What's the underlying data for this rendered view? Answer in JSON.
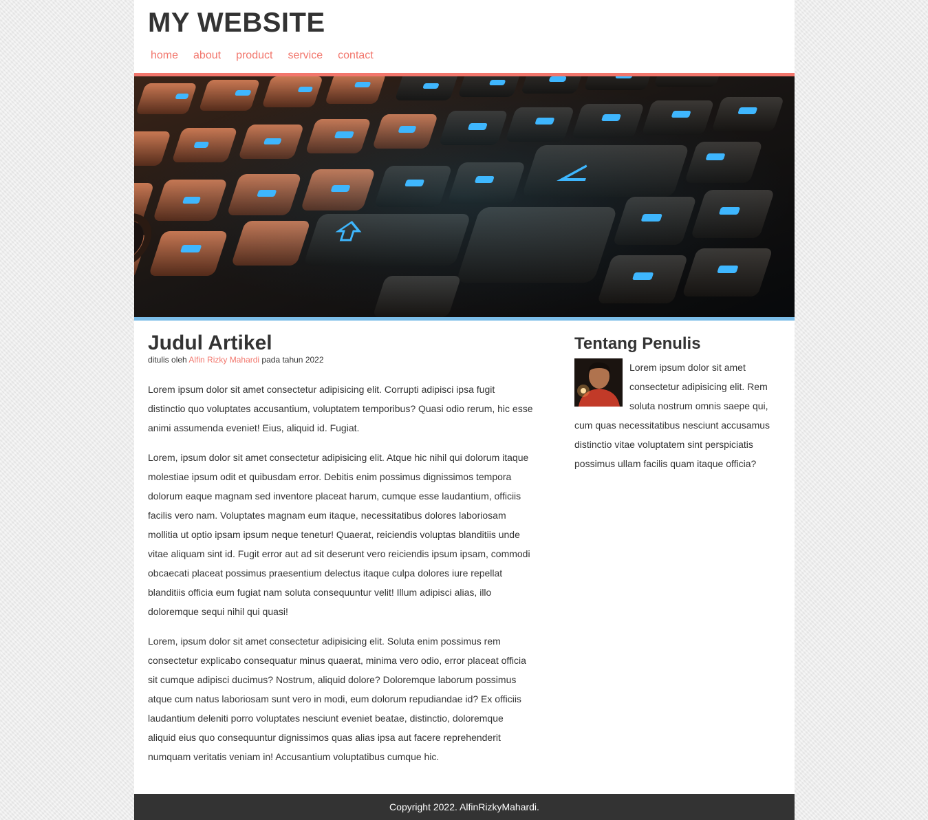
{
  "site": {
    "title": "MY WEBSITE"
  },
  "nav": {
    "items": [
      "home",
      "about",
      "product",
      "service",
      "contact"
    ]
  },
  "colors": {
    "accent": "#f2766c",
    "banner_rule": "#7bbde8",
    "footer_bg": "#333333"
  },
  "article": {
    "title": "Judul Artikel",
    "byline_prefix": "ditulis oleh",
    "author": "Alfin Rizky Mahardi",
    "byline_suffix": "pada tahun 2022",
    "paragraphs": [
      "Lorem ipsum dolor sit amet consectetur adipisicing elit. Corrupti adipisci ipsa fugit distinctio quo voluptates accusantium, voluptatem temporibus? Quasi odio rerum, hic esse animi assumenda eveniet! Eius, aliquid id. Fugiat.",
      "Lorem, ipsum dolor sit amet consectetur adipisicing elit. Atque hic nihil qui dolorum itaque molestiae ipsum odit et quibusdam error. Debitis enim possimus dignissimos tempora dolorum eaque magnam sed inventore placeat harum, cumque esse laudantium, officiis facilis vero nam. Voluptates magnam eum itaque, necessitatibus dolores laboriosam mollitia ut optio ipsam ipsum neque tenetur! Quaerat, reiciendis voluptas blanditiis unde vitae aliquam sint id. Fugit error aut ad sit deserunt vero reiciendis ipsum ipsam, commodi obcaecati placeat possimus praesentium delectus itaque culpa dolores iure repellat blanditiis officia eum fugiat nam soluta consequuntur velit! Illum adipisci alias, illo doloremque sequi nihil qui quasi!",
      "Lorem, ipsum dolor sit amet consectetur adipisicing elit. Soluta enim possimus rem consectetur explicabo consequatur minus quaerat, minima vero odio, error placeat officia sit cumque adipisci ducimus? Nostrum, aliquid dolore? Doloremque laborum possimus atque cum natus laboriosam sunt vero in modi, eum dolorum repudiandae id? Ex officiis laudantium deleniti porro voluptates nesciunt eveniet beatae, distinctio, doloremque aliquid eius quo consequuntur dignissimos quas alias ipsa aut facere reprehenderit numquam veritatis veniam in! Accusantium voluptatibus cumque hic."
    ]
  },
  "sidebar": {
    "title": "Tentang Penulis",
    "bio": "Lorem ipsum dolor sit amet consectetur adipisicing elit. Rem soluta nostrum omnis saepe qui, cum quas necessitatibus nesciunt accusamus distinctio vitae voluptatem sint perspiciatis possimus ullam facilis quam itaque officia?"
  },
  "footer": {
    "text": "Copyright 2022. AlfinRizkyMahardi."
  }
}
